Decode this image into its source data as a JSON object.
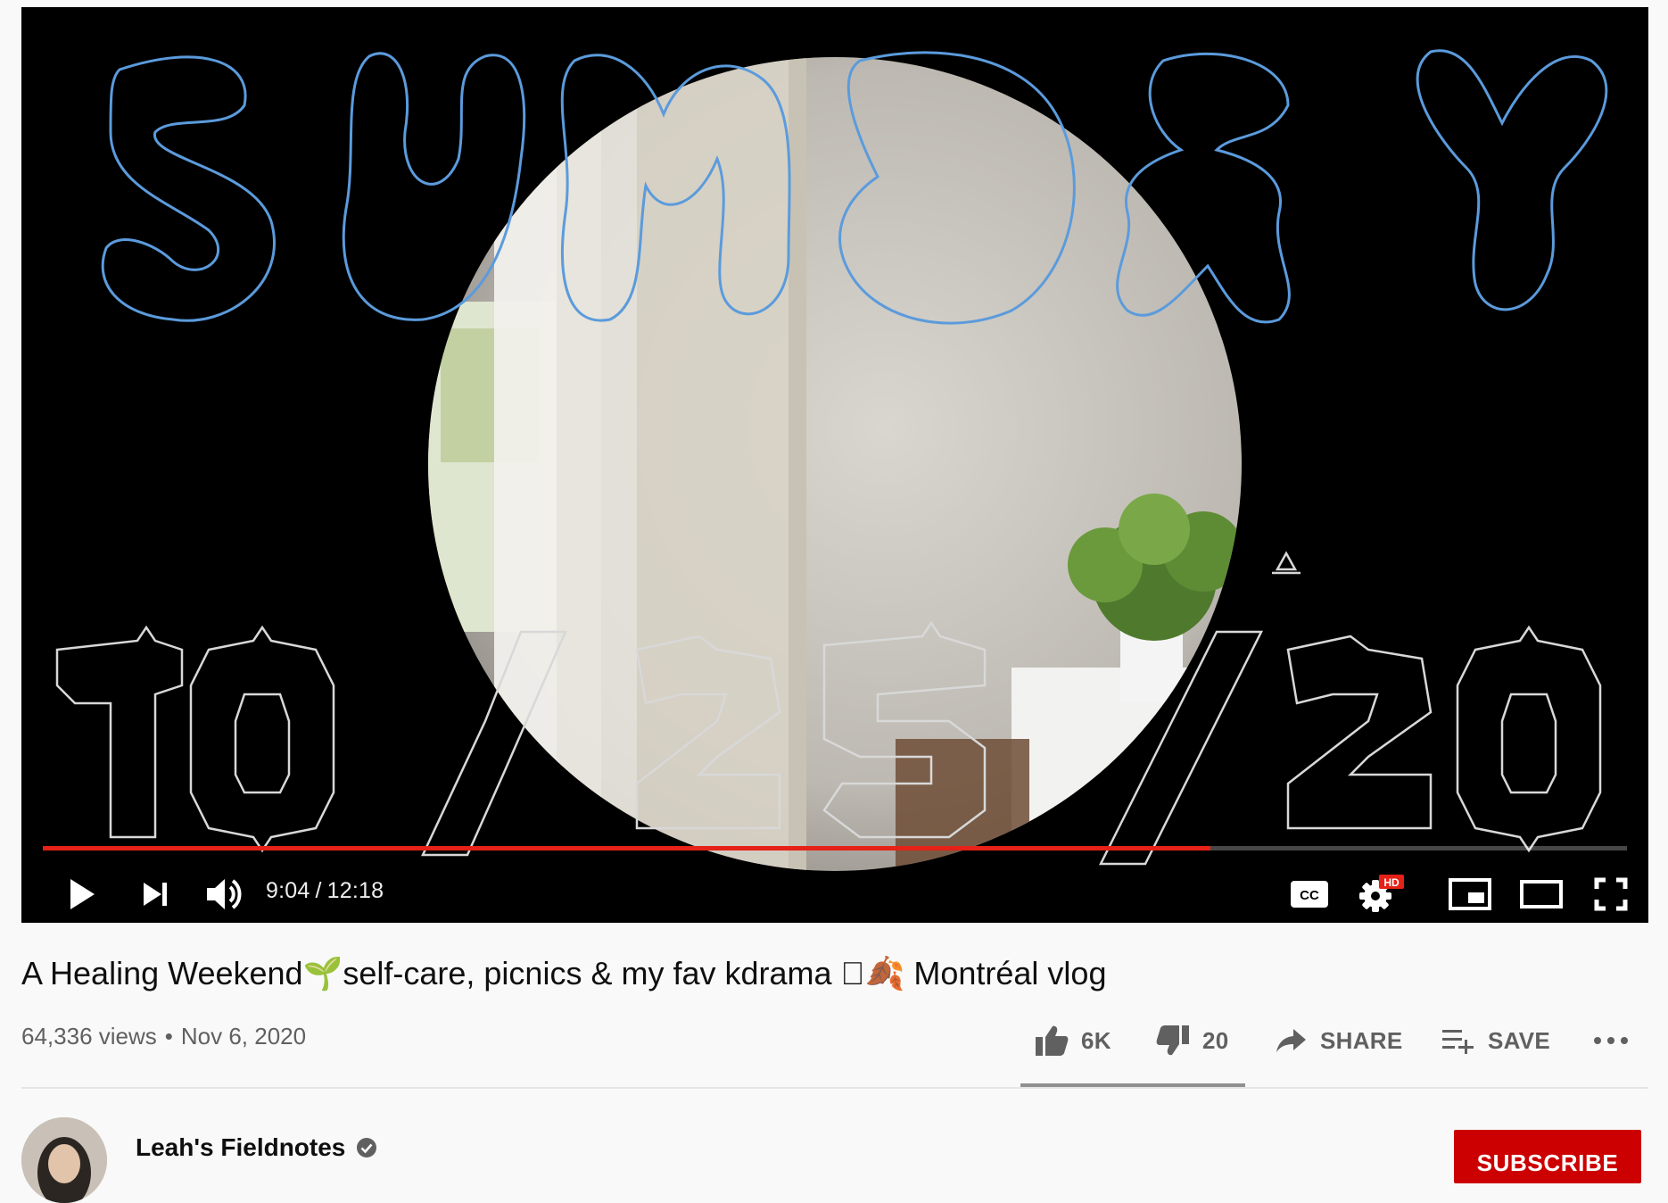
{
  "player": {
    "time_current": "9:04",
    "time_separator": "/",
    "time_total": "12:18",
    "progress_fraction": 0.737,
    "colors": {
      "progress": "#e62117",
      "hd_badge": "#e62117"
    },
    "controls": {
      "play_icon": "play-icon",
      "next_icon": "next-icon",
      "volume_icon": "volume-icon",
      "captions_icon": "captions-icon",
      "captions_label": "CC",
      "settings_icon": "gear-icon",
      "hd_badge": "HD",
      "miniplayer_icon": "miniplayer-icon",
      "theater_icon": "theater-icon",
      "fullscreen_icon": "fullscreen-icon"
    }
  },
  "video": {
    "title": "A Healing Weekend🌱self-care, picnics & my fav kdrama 􏰀🍂 Montréal vlog",
    "views": "64,336 views",
    "dot": "•",
    "date": "Nov 6, 2020"
  },
  "actions": {
    "like_count": "6K",
    "dislike_count": "20",
    "share_label": "SHARE",
    "save_label": "SAVE",
    "more_icon": "more-icon"
  },
  "channel": {
    "name": "Leah's Fieldnotes",
    "verified_icon": "verified-icon",
    "subscribe_label": "SUBSCRIBE"
  }
}
